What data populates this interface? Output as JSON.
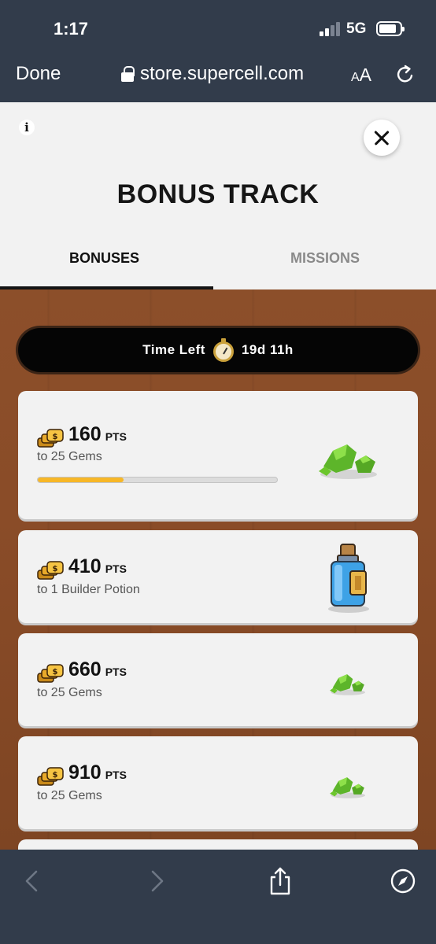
{
  "status_bar": {
    "time": "1:17",
    "network": "5G"
  },
  "browser": {
    "done_label": "Done",
    "url": "store.supercell.com",
    "aa_small": "A",
    "aa_large": "A"
  },
  "modal": {
    "info_label": "i",
    "title": "BONUS TRACK",
    "tabs": [
      {
        "label": "BONUSES",
        "active": true
      },
      {
        "label": "MISSIONS",
        "active": false
      }
    ]
  },
  "timer": {
    "label": "Time Left",
    "value": "19d 11h"
  },
  "bonuses": [
    {
      "points": "160",
      "unit": "PTS",
      "reward": "to 25 Gems",
      "icon": "gem-pile-icon",
      "progress": 0.36
    },
    {
      "points": "410",
      "unit": "PTS",
      "reward": "to 1 Builder Potion",
      "icon": "builder-potion-icon"
    },
    {
      "points": "660",
      "unit": "PTS",
      "reward": "to 25 Gems",
      "icon": "gem-pile-icon"
    },
    {
      "points": "910",
      "unit": "PTS",
      "reward": "to 25 Gems",
      "icon": "gem-pile-icon"
    }
  ],
  "colors": {
    "progress": "#f7b727",
    "wood": "#8a4c28",
    "gem": "#6cc62c"
  }
}
